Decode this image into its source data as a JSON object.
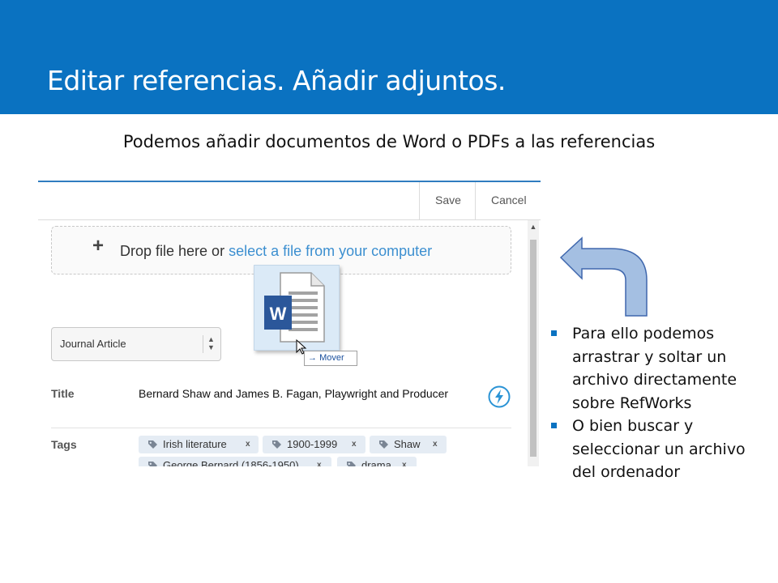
{
  "slide": {
    "title": "Editar referencias. Añadir adjuntos.",
    "subtitle": "Podemos añadir documentos de Word o PDFs a las referencias",
    "colors": {
      "banner": "#0a72c1",
      "link": "#3c8fd0",
      "tag_bg": "#e5ecf4"
    }
  },
  "app": {
    "toolbar": {
      "save_label": "Save",
      "cancel_label": "Cancel"
    },
    "dropzone": {
      "plus": "+",
      "text": "Drop file here or",
      "link_text": "select a file from your computer"
    },
    "drag": {
      "icon": "word-document-icon",
      "icon_letter": "W",
      "tooltip": "Mover",
      "tooltip_arrow": "→"
    },
    "type_select": {
      "value": "Journal Article"
    },
    "fields": {
      "title_label": "Title",
      "title_value": "Bernard Shaw and James B. Fagan, Playwright and Producer",
      "tags_label": "Tags"
    },
    "tags": [
      {
        "label": "Irish literature",
        "remove": "x"
      },
      {
        "label": "1900-1999",
        "remove": "x"
      },
      {
        "label": "Shaw",
        "remove": "x"
      },
      {
        "label": "George Bernard (1856-1950)",
        "remove": "x"
      },
      {
        "label": "drama",
        "remove": "x"
      }
    ]
  },
  "notes": {
    "bullets": [
      "Para ello podemos arrastrar y soltar un archivo directamente sobre RefWorks",
      "O bien buscar y seleccionar un archivo del ordenador"
    ]
  }
}
